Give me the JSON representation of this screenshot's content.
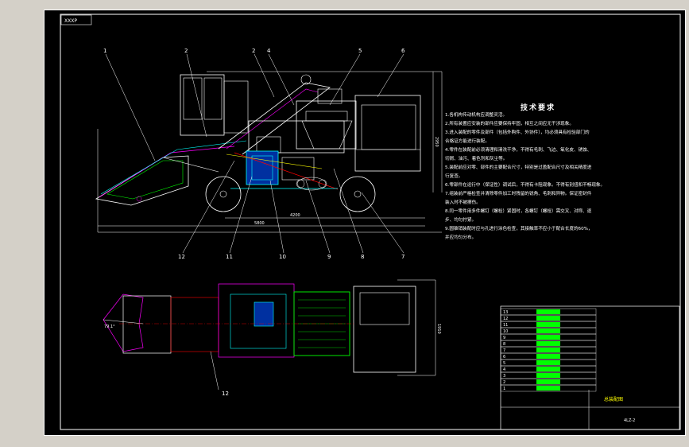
{
  "drawing": {
    "corner_tag": "XXXP",
    "callouts": [
      "1",
      "2",
      "2",
      "4",
      "5",
      "6",
      "7",
      "8",
      "9",
      "10",
      "11",
      "12",
      "12"
    ],
    "dimensions": {
      "length_front": "5800",
      "length_mid": "4200",
      "height": "2950",
      "width_plan": "1910",
      "angle_label": "79.1°"
    }
  },
  "tech_req": {
    "title": "技术要求",
    "items": [
      "1.各机构传动机构应调整灵活。",
      "2.所有装置应安装的部件应要保持牢固，相互之间应无干涉现象。",
      "3.进入装配的零件及部件（包括外购件、外协件），均必须具有检验部门的",
      "  合格证方能进行装配。",
      "4.零件在装配前必须清理和清洗干净，不得有毛刺、飞边、氧化皮、锈蚀、",
      "  切屑、油污、着色剂和灰尘等。",
      "5.装配前应对零、部件的主要配合尺寸，特别是过盈配合尺寸及相关精度进",
      "  行复查。",
      "6.零部件在运行中（保证性）调试后，不得有卡阻现象。不得有别扭和不畅现象。",
      "7.组装前严格检查并清除零件加工时残留的锐角、毛刺和异物。保证密封件",
      "  装入时不被擦伤。",
      "8.同一零件用多件螺钉（螺栓）紧固时，各螺钉（螺栓）需交叉、对称、逐",
      "  步、均匀拧紧。",
      "9.圆锥销装配时应与孔进行涂色检查，其接触率不应小于配合长度的60%，",
      "  并应均匀分布。"
    ]
  },
  "title_block": {
    "parts_rows": [
      "13",
      "12",
      "11",
      "10",
      "9",
      "8",
      "7",
      "6",
      "5",
      "4",
      "3",
      "2",
      "1"
    ],
    "drawing_name": "总装配图",
    "code": "4LZ-2"
  },
  "colors": {
    "background": "#000000",
    "frame": "#ffffff",
    "accent_cyan": "#00ffff",
    "accent_magenta": "#ff00ff",
    "accent_green": "#00ff00",
    "accent_red": "#ff0000",
    "accent_yellow": "#ffff00"
  }
}
